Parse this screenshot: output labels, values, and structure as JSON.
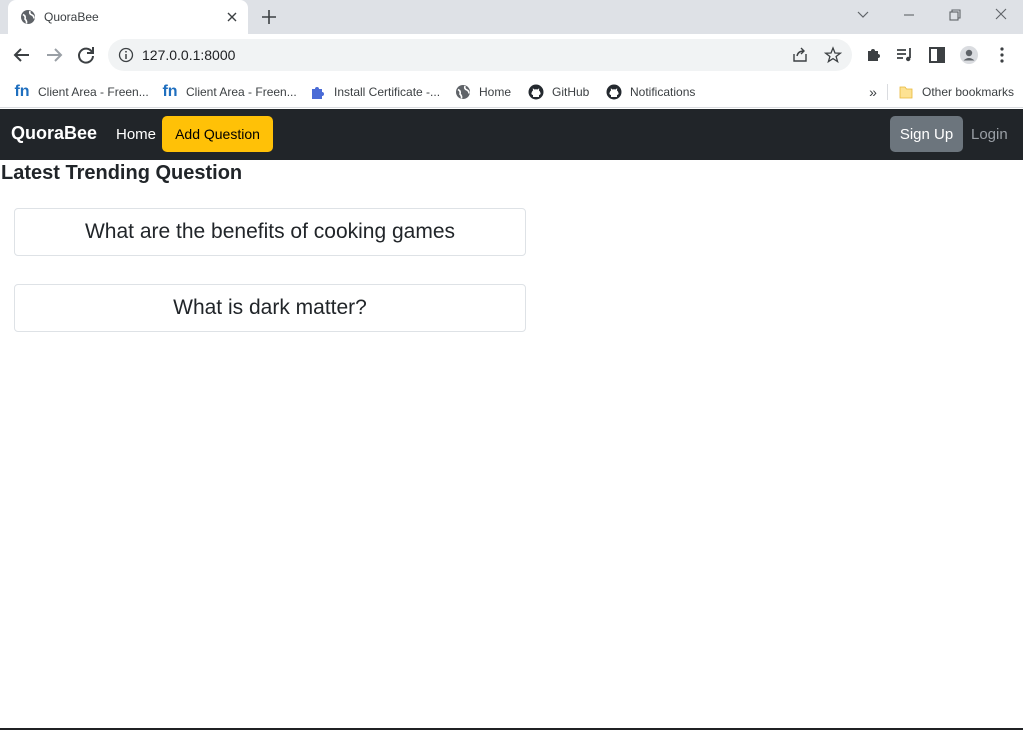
{
  "browser": {
    "tab_title": "QuoraBee",
    "url": "127.0.0.1:8000",
    "bookmarks": [
      {
        "label": "Client Area - Freen...",
        "icon": "freenom-icon"
      },
      {
        "label": "Client Area - Freen...",
        "icon": "freenom-icon"
      },
      {
        "label": "Install Certificate -...",
        "icon": "puzzle-icon"
      },
      {
        "label": "Home",
        "icon": "globe-icon"
      },
      {
        "label": "GitHub",
        "icon": "github-icon"
      },
      {
        "label": "Notifications",
        "icon": "github-icon"
      }
    ],
    "bookmarks_more": "»",
    "other_bookmarks": "Other bookmarks",
    "freenom_glyph": "fn"
  },
  "navbar": {
    "brand": "QuoraBee",
    "home": "Home",
    "add_question": "Add Question",
    "sign_up": "Sign Up",
    "login": "Login"
  },
  "main": {
    "heading": "Latest Trending Question",
    "questions": [
      "What are the benefits of cooking games",
      "What is dark matter?"
    ]
  },
  "colors": {
    "navbar_bg": "#212529",
    "add_button": "#ffc107",
    "signup_button": "#6c757d"
  }
}
